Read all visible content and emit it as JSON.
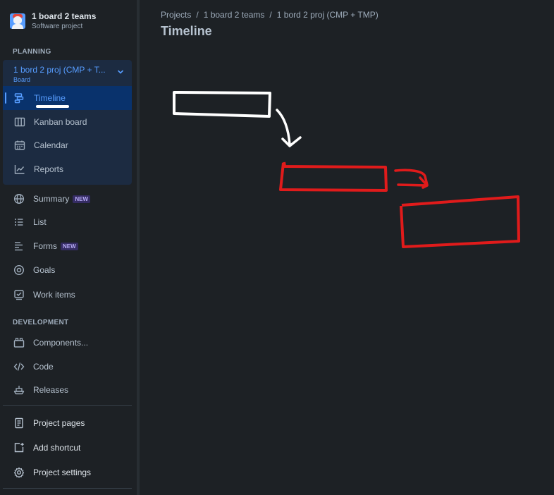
{
  "project": {
    "name": "1 board 2 teams",
    "type": "Software project"
  },
  "sidebar": {
    "planning_label": "PLANNING",
    "board": {
      "title": "1 bord 2 proj (CMP + T...",
      "subtitle": "Board",
      "items": [
        {
          "label": "Timeline",
          "icon": "timeline-icon",
          "active": true
        },
        {
          "label": "Kanban board",
          "icon": "kanban-icon"
        },
        {
          "label": "Calendar",
          "icon": "calendar-icon"
        },
        {
          "label": "Reports",
          "icon": "reports-icon"
        }
      ]
    },
    "items": [
      {
        "label": "Summary",
        "icon": "globe-icon",
        "badge": "NEW"
      },
      {
        "label": "List",
        "icon": "list-icon"
      },
      {
        "label": "Forms",
        "icon": "forms-icon",
        "badge": "NEW"
      },
      {
        "label": "Goals",
        "icon": "goals-icon"
      },
      {
        "label": "Work items",
        "icon": "work-items-icon"
      }
    ],
    "development_label": "DEVELOPMENT",
    "dev_items": [
      {
        "label": "Components...",
        "icon": "components-icon"
      },
      {
        "label": "Code",
        "icon": "code-icon"
      },
      {
        "label": "Releases",
        "icon": "releases-icon"
      }
    ],
    "footer_items": [
      {
        "label": "Project pages",
        "icon": "page-icon"
      },
      {
        "label": "Add shortcut",
        "icon": "add-shortcut-icon"
      },
      {
        "label": "Project settings",
        "icon": "gear-icon"
      }
    ]
  },
  "breadcrumb": [
    "Projects",
    "1 board 2 teams",
    "1 bord 2 proj (CMP + TMP)"
  ],
  "page": {
    "title": "Timeline"
  },
  "colors": {
    "accent": "#579dff",
    "annotation_white": "#ffffff",
    "annotation_red": "#e01b1b"
  }
}
